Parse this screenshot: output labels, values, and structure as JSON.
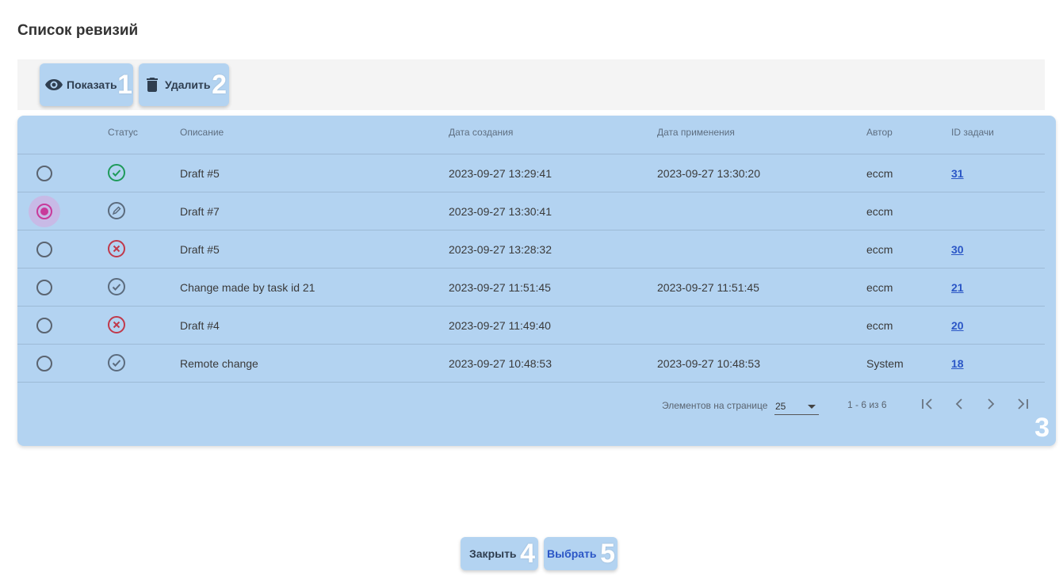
{
  "page": {
    "title": "Список ревизий"
  },
  "toolbar": {
    "show": {
      "label": "Показать",
      "marker": "1",
      "icon": "eye-icon"
    },
    "delete": {
      "label": "Удалить",
      "marker": "2",
      "icon": "trash-icon"
    }
  },
  "table": {
    "marker": "3",
    "columns": [
      "Статус",
      "Описание",
      "Дата создания",
      "Дата применения",
      "Автор",
      "ID задачи"
    ],
    "rows": [
      {
        "selected": false,
        "status": "applied",
        "description": "Draft #5",
        "created": "2023-09-27 13:29:41",
        "applied": "2023-09-27 13:30:20",
        "author": "eccm",
        "task_id": "31"
      },
      {
        "selected": true,
        "status": "draft",
        "description": "Draft #7",
        "created": "2023-09-27 13:30:41",
        "applied": "",
        "author": "eccm",
        "task_id": ""
      },
      {
        "selected": false,
        "status": "rejected",
        "description": "Draft #5",
        "created": "2023-09-27 13:28:32",
        "applied": "",
        "author": "eccm",
        "task_id": "30"
      },
      {
        "selected": false,
        "status": "done",
        "description": "Change made by task id 21",
        "created": "2023-09-27 11:51:45",
        "applied": "2023-09-27 11:51:45",
        "author": "eccm",
        "task_id": "21"
      },
      {
        "selected": false,
        "status": "rejected",
        "description": "Draft #4",
        "created": "2023-09-27 11:49:40",
        "applied": "",
        "author": "eccm",
        "task_id": "20"
      },
      {
        "selected": false,
        "status": "done",
        "description": "Remote change",
        "created": "2023-09-27 10:48:53",
        "applied": "2023-09-27 10:48:53",
        "author": "System",
        "task_id": "18"
      }
    ]
  },
  "paginator": {
    "items_per_page_label": "Элементов на странице",
    "page_size": "25",
    "range": "1 - 6 из 6"
  },
  "footer": {
    "close": {
      "label": "Закрыть",
      "marker": "4"
    },
    "select": {
      "label": "Выбрать",
      "marker": "5"
    }
  },
  "colors": {
    "highlight": "#b3d3f1",
    "status_applied": "#1e9a5a",
    "status_rejected": "#c0394b",
    "status_neutral": "#5b6b7d",
    "radio_selected": "#c83a9a",
    "link": "#2b56c6"
  }
}
